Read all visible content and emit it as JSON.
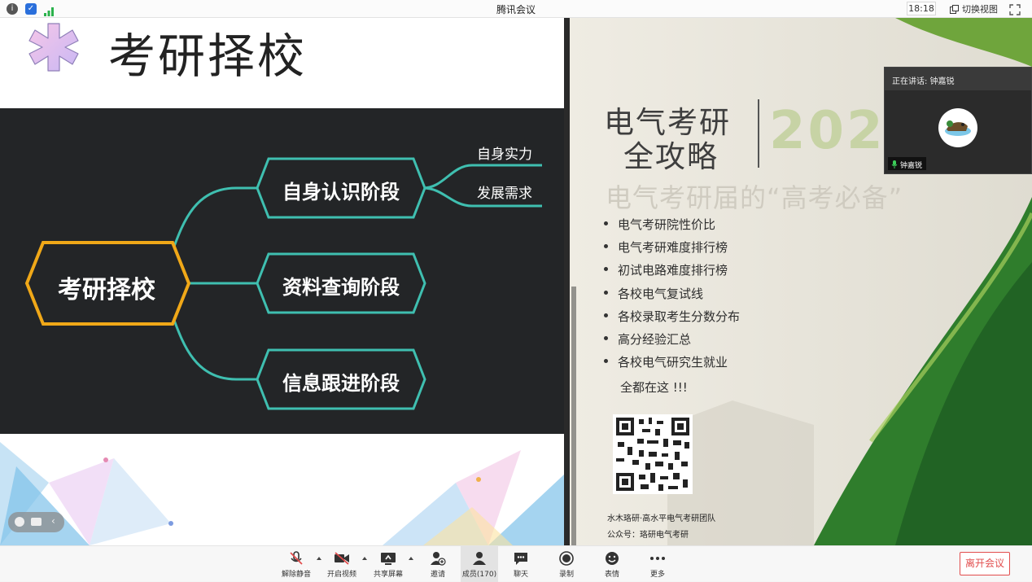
{
  "titlebar": {
    "title": "腾讯会议",
    "time": "18:18",
    "switch_view": "切换视图"
  },
  "slide": {
    "title": "考研择校",
    "root_node": "考研择校",
    "branches": [
      "自身认识阶段",
      "资料查询阶段",
      "信息跟进阶段"
    ],
    "sub_branches": [
      "自身实力",
      "发展需求"
    ]
  },
  "camera": {
    "title_line1": "电气考研",
    "title_line2": "全攻略",
    "year_partial": "202",
    "slogan": "电气考研届的“高考必备”",
    "bullets": [
      "电气考研院性价比",
      "电气考研难度排行榜",
      "初试电路难度排行榜",
      "各校电气复试线",
      "各校录取考生分数分布",
      "高分经验汇总",
      "各校电气研究生就业"
    ],
    "all_here": "全都在这 !!!",
    "footer_team": "水木珞研·高水平电气考研团队",
    "footer_account": "公众号：珞研电气考研"
  },
  "speaker": {
    "label": "正在讲话: 钟嘉锐",
    "name": "钟嘉锐"
  },
  "toolbar": {
    "unmute": "解除静音",
    "video": "开启视频",
    "share": "共享屏幕",
    "invite": "邀请",
    "members": "成员(170)",
    "chat": "聊天",
    "record": "录制",
    "emoji": "表情",
    "more": "更多",
    "leave": "离开会议"
  },
  "colors": {
    "accent_teal": "#3fbfb0",
    "accent_gold": "#f0a818",
    "leave_red": "#e24d4d"
  }
}
